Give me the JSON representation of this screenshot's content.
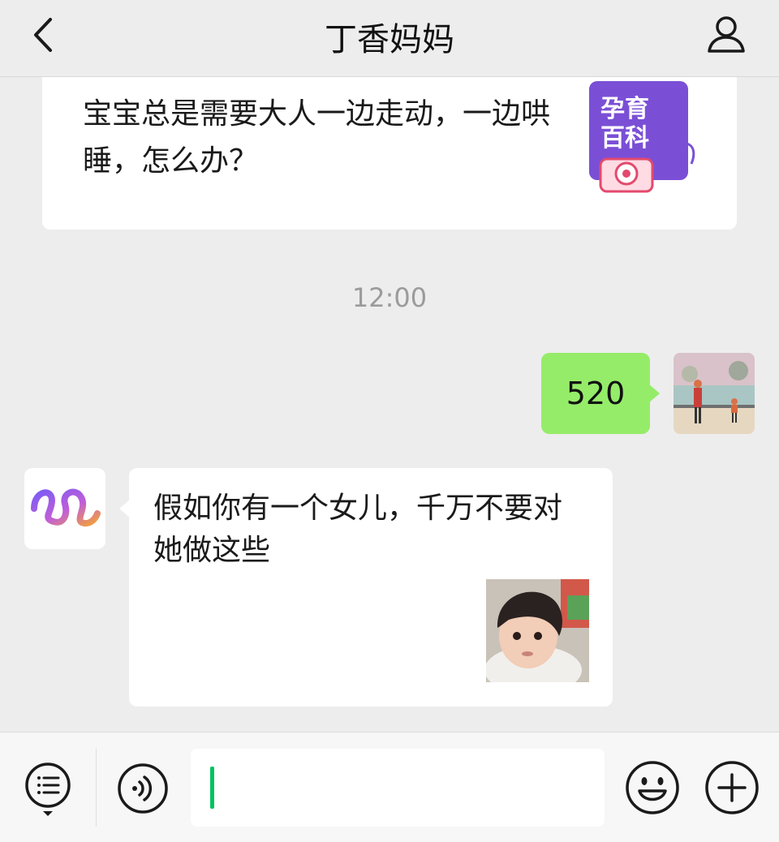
{
  "header": {
    "title": "丁香妈妈",
    "back_icon": "chevron-left-icon",
    "profile_icon": "person-icon"
  },
  "card": {
    "text": "宝宝总是需要大人一边走动，一边哄睡，怎么办？",
    "thumb_line1": "孕育",
    "thumb_line2": "百科",
    "thumb_color": "#7a4fd6"
  },
  "timestamp": "12:00",
  "my_message": {
    "text": "520",
    "bubble_color": "#95ec69"
  },
  "their_message": {
    "text": "假如你有一个女儿，千万不要对她做这些"
  },
  "toolbar": {
    "menu_icon": "list-menu-icon",
    "voice_icon": "voice-icon",
    "emoji_icon": "emoji-icon",
    "plus_icon": "plus-icon",
    "input_value": "",
    "caret_color": "#07c160"
  }
}
